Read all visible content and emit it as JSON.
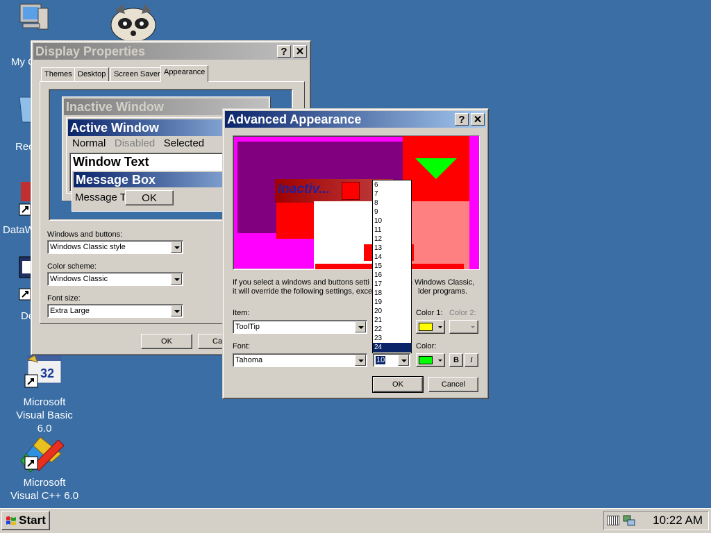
{
  "desktop": {
    "icons": [
      {
        "label": "My C",
        "name": "my-computer"
      },
      {
        "label": "Rec",
        "name": "recycle-bin"
      },
      {
        "label": "DataW",
        "name": "dataw"
      },
      {
        "label": "De",
        "name": "de"
      },
      {
        "label": "Microsoft Visual Basic 6.0",
        "name": "vb6"
      },
      {
        "label": "Microsoft Visual C++ 6.0",
        "name": "vc6"
      }
    ],
    "background_color": "#3a6ea5"
  },
  "display_properties": {
    "title": "Display Properties",
    "help": "?",
    "close": "✕",
    "tabs": [
      "Themes",
      "Desktop",
      "Screen Saver",
      "Appearance"
    ],
    "selected_tab": "Appearance",
    "preview": {
      "inactive_title": "Inactive Window",
      "active_title": "Active Window",
      "menu_normal": "Normal",
      "menu_disabled": "Disabled",
      "menu_selected": "Selected",
      "window_text": "Window Text",
      "msgbox_title": "Message Box",
      "msgbox_text": "Message T",
      "ok": "OK"
    },
    "windows_buttons_label": "Windows and buttons:",
    "windows_buttons_value": "Windows Classic style",
    "color_scheme_label": "Color scheme:",
    "color_scheme_value": "Windows Classic",
    "font_size_label": "Font size:",
    "font_size_value": "Extra Large",
    "ok": "OK",
    "cancel": "Car"
  },
  "advanced": {
    "title": "Advanced Appearance",
    "help": "?",
    "close": "✕",
    "preview_inactive": "Inactiv...",
    "info_line1_a": "If you select a windows and buttons setti",
    "info_line1_b": "n Windows Classic,",
    "info_line2_a": "it will override the following settings, exce",
    "info_line2_b": "lder programs.",
    "item_label": "Item:",
    "item_value": "ToolTip",
    "color1_label": "Color 1:",
    "color2_label": "Color 2:",
    "color1": "#ffff00",
    "font_label": "Font:",
    "font_value": "Tahoma",
    "size_value": "10",
    "color_label": "Color:",
    "font_color": "#00ff00",
    "bold": "B",
    "italic": "I",
    "ok": "OK",
    "cancel": "Cancel",
    "size_options": [
      "6",
      "7",
      "8",
      "9",
      "10",
      "11",
      "12",
      "13",
      "14",
      "15",
      "16",
      "17",
      "18",
      "19",
      "20",
      "21",
      "22",
      "23",
      "24"
    ],
    "size_highlighted": "24"
  },
  "taskbar": {
    "start": "Start",
    "clock": "10:22 AM"
  }
}
